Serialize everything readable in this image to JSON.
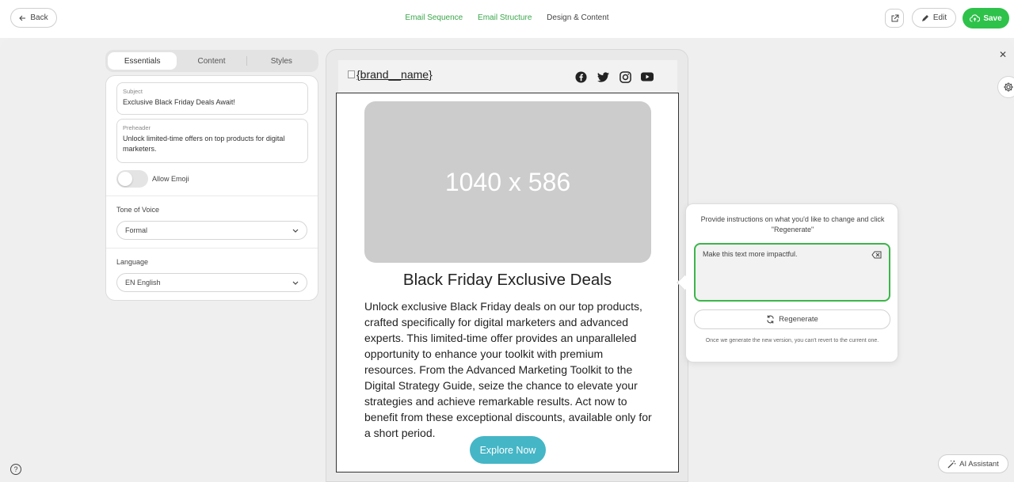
{
  "topbar": {
    "back_label": "Back",
    "steps": [
      "Email Sequence",
      "Email Structure",
      "Design & Content"
    ],
    "edit_label": "Edit",
    "save_label": "Save"
  },
  "panel": {
    "tabs": [
      "Essentials",
      "Content",
      "Styles"
    ],
    "active_tab": "Essentials",
    "subject_label": "Subject",
    "subject_value": "Exclusive Black Friday Deals Await!",
    "preheader_label": "Preheader",
    "preheader_value": "Unlock limited-time offers on top products for digital marketers.",
    "emoji_label": "Allow Emoji",
    "emoji_enabled": false,
    "tone_label": "Tone of Voice",
    "tone_value": "Formal",
    "language_label": "Language",
    "language_value": "EN English"
  },
  "email": {
    "brand_alt": "{brand__name}",
    "social_icons": [
      "facebook-icon",
      "twitter-icon",
      "instagram-icon",
      "youtube-icon"
    ],
    "hero_placeholder": "1040 x 586",
    "headline": "Black Friday Exclusive Deals",
    "body": "Unlock exclusive Black Friday deals on our top products, crafted specifically for digital marketers and advanced experts. This limited-time offer provides an unparalleled opportunity to enhance your toolkit with premium resources. From the Advanced Marketing Toolkit to the Digital Strategy Guide, seize the chance to elevate your strategies and achieve remarkable results. Act now to benefit from these exceptional discounts, available only for a short period.",
    "cta_label": "Explore Now"
  },
  "ai_popover": {
    "title": "Provide instructions on what you'd like to change and click \"Regenerate\"",
    "prompt_value": "Make this text more impactful.",
    "regenerate_label": "Regenerate",
    "note": "Once we generate the new version, you can't revert to the current one."
  },
  "footer": {
    "help_glyph": "?",
    "ai_assistant_label": "AI Assistant"
  },
  "colors": {
    "accent_green": "#2ec24a",
    "step_green": "#3aa64a",
    "cta_teal": "#45b6c6"
  }
}
